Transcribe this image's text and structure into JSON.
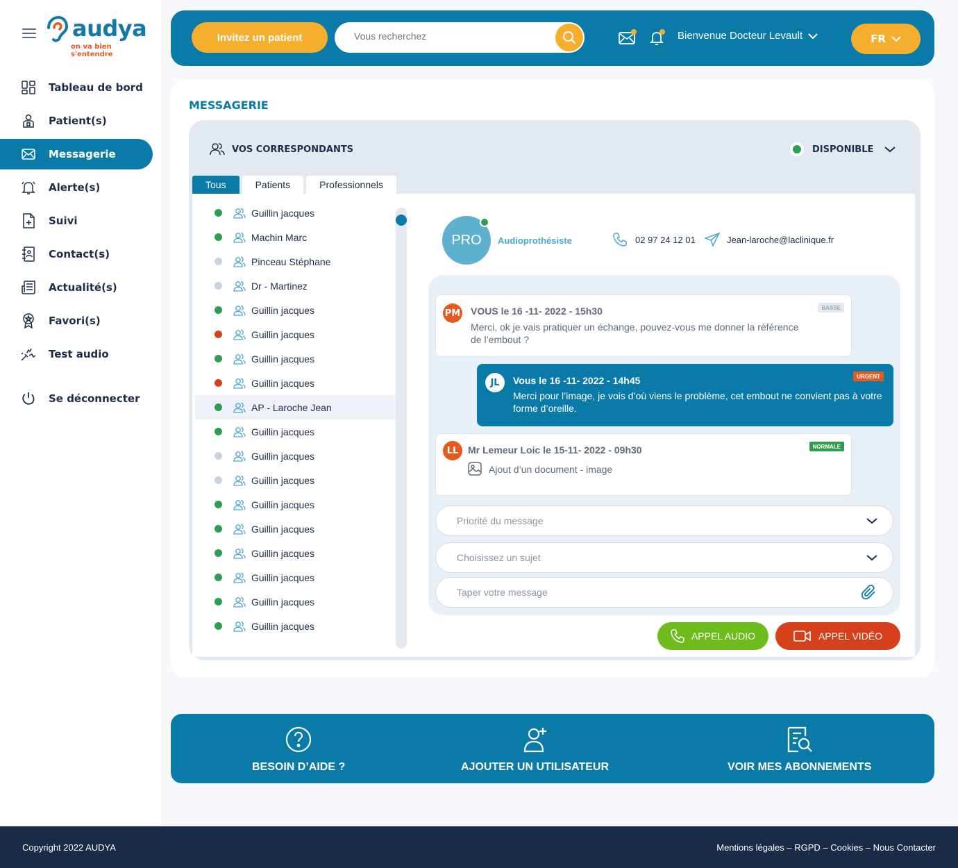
{
  "brand": {
    "name": "audya",
    "tagline": "on va bien s'entendre",
    "primary_color": "#0a7aa9",
    "accent_color": "#f6ae2d",
    "orange_color": "#e65a1f"
  },
  "sidebar": {
    "items": [
      {
        "label": "Tableau de bord",
        "icon": "dashboard-icon"
      },
      {
        "label": "Patient(s)",
        "icon": "patient-icon"
      },
      {
        "label": "Messagerie",
        "icon": "mail-icon",
        "active": true
      },
      {
        "label": "Alerte(s)",
        "icon": "bell-icon"
      },
      {
        "label": "Suivi",
        "icon": "document-add-icon"
      },
      {
        "label": "Contact(s)",
        "icon": "contacts-book-icon"
      },
      {
        "label": "Actualité(s)",
        "icon": "news-icon"
      },
      {
        "label": "Favori(s)",
        "icon": "favorite-badge-icon"
      },
      {
        "label": "Test audio",
        "icon": "audio-test-icon"
      }
    ],
    "logout": "Se déconnecter"
  },
  "header": {
    "invite_label": "Invitez un patient",
    "search_placeholder": "Vous recherchez",
    "welcome": "Bienvenue Docteur Levault",
    "lang": "FR"
  },
  "main": {
    "title": "MESSAGERIE",
    "correspondants_title": "VOS CORRESPONDANTS",
    "status": "DISPONIBLE",
    "tabs": [
      "Tous",
      "Patients",
      "Professionnels"
    ],
    "contacts": [
      {
        "name": "Guillin jacques",
        "status": "online"
      },
      {
        "name": "Machin Marc",
        "status": "online"
      },
      {
        "name": "Pinceau Stéphane",
        "status": "offline"
      },
      {
        "name": "Dr - Martinez",
        "status": "offline"
      },
      {
        "name": "Guillin jacques",
        "status": "online"
      },
      {
        "name": "Guillin jacques",
        "status": "busy"
      },
      {
        "name": "Guillin jacques",
        "status": "online"
      },
      {
        "name": "Guillin jacques",
        "status": "busy"
      },
      {
        "name": "AP - Laroche Jean",
        "status": "online",
        "selected": true
      },
      {
        "name": "Guillin jacques",
        "status": "online"
      },
      {
        "name": "Guillin jacques",
        "status": "offline"
      },
      {
        "name": "Guillin jacques",
        "status": "offline"
      },
      {
        "name": "Guillin jacques",
        "status": "online"
      },
      {
        "name": "Guillin jacques",
        "status": "online"
      },
      {
        "name": "Guillin jacques",
        "status": "online"
      },
      {
        "name": "Guillin jacques",
        "status": "online"
      },
      {
        "name": "Guillin jacques",
        "status": "online"
      },
      {
        "name": "Guillin jacques",
        "status": "online"
      }
    ],
    "status_colors": {
      "online": "#2e9e52",
      "offline": "#c9d3df",
      "busy": "#d6411c"
    },
    "conversation": {
      "avatar": "PRO",
      "role": "Audioprothésiste",
      "phone": "02 97 24 12 01",
      "email": "Jean-laroche@laclinique.fr",
      "messages": [
        {
          "initials": "PM",
          "header": "VOUS le 16 -11- 2022 - 15h30",
          "body": "Merci, ok je vais pratiquer un échange, pouvez-vous me donner la référence de l’embout ?",
          "badge": "BASSE"
        },
        {
          "initials": "JL",
          "header": "Vous le 16 -11- 2022 - 14h45",
          "body": "Merci pour l’image, je vois d’où viens le problème, cet embout ne convient pas à votre forme d’oreille.",
          "badge": "URGENT"
        },
        {
          "initials": "LL",
          "header": "Mr Lemeur Loic le 15-11- 2022 - 09h30",
          "body": "Ajout d’un document - image",
          "badge": "NORMALE"
        }
      ],
      "priority_placeholder": "Priorité du message",
      "subject_placeholder": "Choisissez un sujet",
      "message_placeholder": "Taper votre message",
      "audio_call": "APPEL AUDIO",
      "video_call": "APPEL VIDÉO"
    }
  },
  "bottom": {
    "help": "BESOIN D’AIDE ?",
    "add_user": "AJOUTER UN UTILISATEUR",
    "subscriptions": "VOIR MES ABONNEMENTS"
  },
  "footer": {
    "copyright": "Copyright 2022 AUDYA",
    "links": "Mentions légales – RGPD – Cookies – Nous Contacter"
  }
}
